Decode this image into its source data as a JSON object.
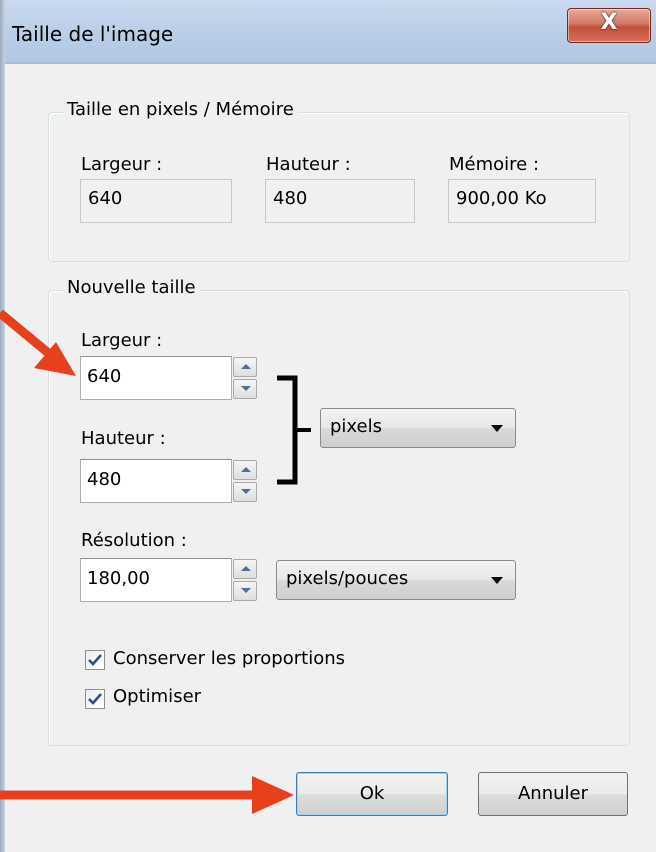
{
  "window": {
    "title": "Taille de l'image",
    "close_label": "X"
  },
  "current_size": {
    "legend": "Taille en pixels / Mémoire",
    "width_label": "Largeur :",
    "width_value": "640",
    "height_label": "Hauteur :",
    "height_value": "480",
    "memory_label": "Mémoire :",
    "memory_value": "900,00 Ko"
  },
  "new_size": {
    "legend": "Nouvelle taille",
    "width_label": "Largeur :",
    "width_value": "640",
    "height_label": "Hauteur :",
    "height_value": "480",
    "unit_selected": "pixels",
    "resolution_label": "Résolution :",
    "resolution_value": "180,00",
    "resolution_unit_selected": "pixels/pouces",
    "keep_proportions_label": "Conserver les proportions",
    "keep_proportions_checked": true,
    "optimize_label": "Optimiser",
    "optimize_checked": true
  },
  "buttons": {
    "ok_label": "Ok",
    "cancel_label": "Annuler"
  },
  "annotation": {
    "arrow_color": "#e8401c"
  }
}
